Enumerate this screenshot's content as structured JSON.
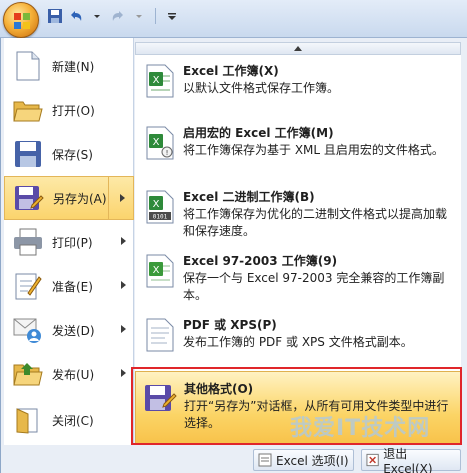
{
  "quick_access": {
    "items": [
      "save-icon",
      "undo-icon",
      "redo-icon",
      "customize-icon"
    ]
  },
  "left_menu": {
    "items": [
      {
        "label": "新建(N)",
        "icon": "new-document-icon",
        "arrow": false
      },
      {
        "label": "打开(O)",
        "icon": "open-folder-icon",
        "arrow": false
      },
      {
        "label": "保存(S)",
        "icon": "save-disk-icon",
        "arrow": false
      },
      {
        "label": "另存为(A)",
        "icon": "save-as-icon",
        "arrow": true,
        "selected": true
      },
      {
        "label": "打印(P)",
        "icon": "print-icon",
        "arrow": true
      },
      {
        "label": "准备(E)",
        "icon": "prepare-icon",
        "arrow": true
      },
      {
        "label": "发送(D)",
        "icon": "send-icon",
        "arrow": true
      },
      {
        "label": "发布(U)",
        "icon": "publish-icon",
        "arrow": true
      },
      {
        "label": "关闭(C)",
        "icon": "close-folder-icon",
        "arrow": false
      }
    ]
  },
  "save_as_options": [
    {
      "title": "Excel 工作簿(X)",
      "desc": "以默认文件格式保存工作簿。",
      "icon": "excel-workbook-icon"
    },
    {
      "title": "启用宏的 Excel 工作簿(M)",
      "desc": "将工作簿保存为基于 XML 且启用宏的文件格式。",
      "icon": "macro-workbook-icon"
    },
    {
      "title": "Excel 二进制工作簿(B)",
      "desc": "将工作簿保存为优化的二进制文件格式以提高加载和保存速度。",
      "icon": "binary-workbook-icon"
    },
    {
      "title": "Excel 97-2003 工作簿(9)",
      "desc": "保存一个与 Excel 97-2003 完全兼容的工作簿副本。",
      "icon": "excel-97-icon"
    },
    {
      "title": "PDF 或 XPS(P)",
      "desc": "发布工作簿的 PDF 或 XPS 文件格式副本。",
      "icon": "pdf-xps-icon"
    },
    {
      "title": "其他格式(O)",
      "desc": "打开“另存为”对话框，从所有可用文件类型中进行选择。",
      "icon": "other-formats-icon",
      "highlight": true
    }
  ],
  "bottom": {
    "options_label": "Excel 选项(I)",
    "exit_label": "退出 Excel(X)"
  },
  "watermark": "我爱IT技术网"
}
